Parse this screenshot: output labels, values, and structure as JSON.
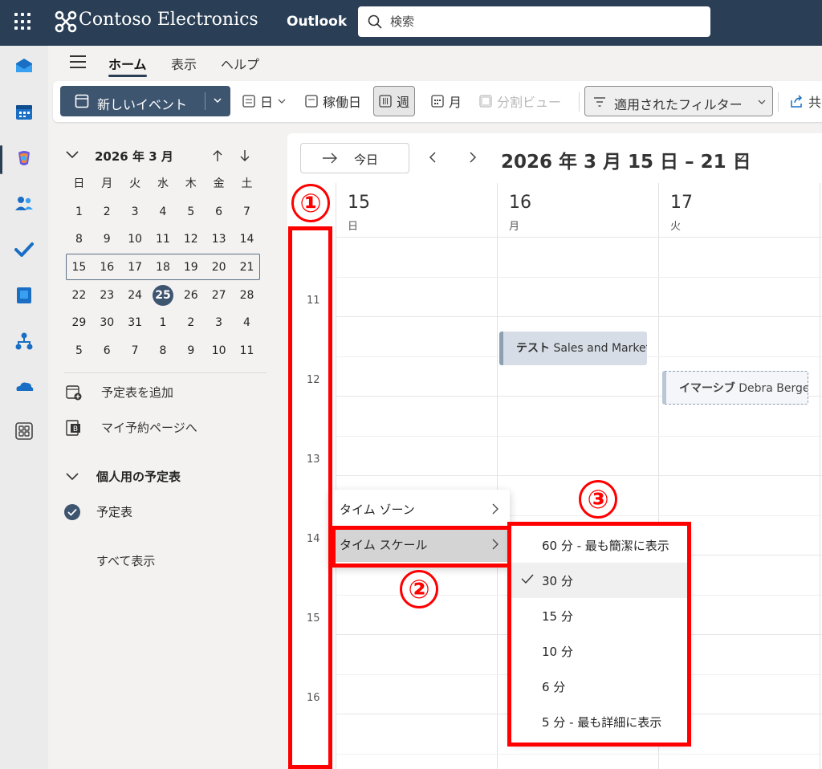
{
  "header": {
    "brand": "Contoso Electronics",
    "app_name": "Outlook",
    "search_placeholder": "検索"
  },
  "ribbon": {
    "tabs": [
      "ホーム",
      "表示",
      "ヘルプ"
    ],
    "active_tab": "ホーム"
  },
  "toolbar": {
    "new_event": "新しいイベント",
    "views": {
      "day": "日",
      "work_week": "稼働日",
      "week": "週",
      "month": "月",
      "split": "分割ビュー"
    },
    "selected_view": "週",
    "filter": "適用されたフィルター",
    "share": "共"
  },
  "mini_calendar": {
    "title": "2026 年 3 月",
    "weekdays": [
      "日",
      "月",
      "火",
      "水",
      "木",
      "金",
      "土"
    ],
    "weeks": [
      [
        "1",
        "2",
        "3",
        "4",
        "5",
        "6",
        "7"
      ],
      [
        "8",
        "9",
        "10",
        "11",
        "12",
        "13",
        "14"
      ],
      [
        "15",
        "16",
        "17",
        "18",
        "19",
        "20",
        "21"
      ],
      [
        "22",
        "23",
        "24",
        "25",
        "26",
        "27",
        "28"
      ],
      [
        "29",
        "30",
        "31",
        "1",
        "2",
        "3",
        "4"
      ],
      [
        "5",
        "6",
        "7",
        "8",
        "9",
        "10",
        "11"
      ]
    ],
    "today": "25",
    "selected_week_index": 2
  },
  "sidebar": {
    "add_calendar": "予定表を追加",
    "booking_page": "マイ予約ページへ",
    "group_title": "個人用の予定表",
    "calendar_name": "予定表",
    "show_all": "すべて表示"
  },
  "calendar": {
    "today_label": "今日",
    "range_title": "2026 年 3 月 15 日 – 21 日",
    "days": [
      {
        "num": "15",
        "name": "日"
      },
      {
        "num": "16",
        "name": "月"
      },
      {
        "num": "17",
        "name": "火"
      }
    ],
    "hours": [
      "11",
      "12",
      "13",
      "14",
      "15",
      "16"
    ],
    "events": [
      {
        "tag": "テスト",
        "title": "Sales and Marketin"
      },
      {
        "tag": "イマーシブ",
        "title": "Debra Berger"
      }
    ]
  },
  "context_menu": {
    "items": [
      "タイム ゾーン",
      "タイム スケール"
    ],
    "highlighted": "タイム スケール"
  },
  "time_scale_menu": {
    "options": [
      "60 分 - 最も簡潔に表示",
      "30 分",
      "15 分",
      "10 分",
      "6 分",
      "5 分 - 最も詳細に表示"
    ],
    "checked": "30 分"
  },
  "annotations": [
    "①",
    "②",
    "③"
  ],
  "colors": {
    "header_bg": "#2a3f55",
    "accent": "#3e5570",
    "annotation": "#ff0000"
  }
}
